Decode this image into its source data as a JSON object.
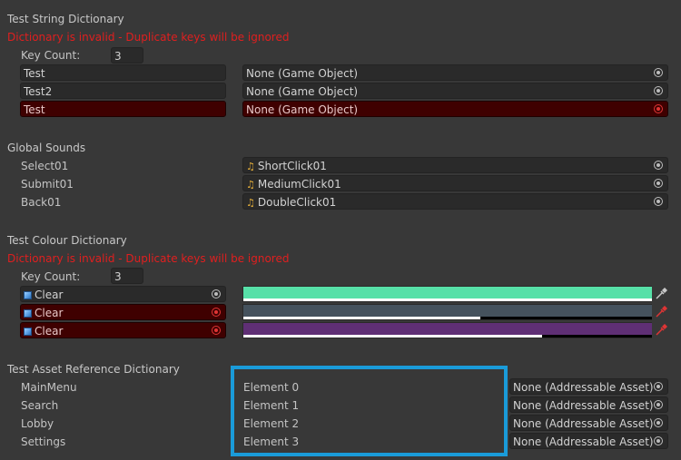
{
  "string_dict": {
    "title": "Test String Dictionary",
    "error": "Dictionary is invalid - Duplicate keys will be ignored",
    "key_count_label": "Key Count:",
    "key_count": "3",
    "entries": [
      {
        "key": "Test",
        "value": "None (Game Object)",
        "duplicate": false
      },
      {
        "key": "Test2",
        "value": "None (Game Object)",
        "duplicate": false
      },
      {
        "key": "Test",
        "value": "None (Game Object)",
        "duplicate": true
      }
    ]
  },
  "global_sounds": {
    "title": "Global Sounds",
    "entries": [
      {
        "key": "Select01",
        "value": "ShortClick01"
      },
      {
        "key": "Submit01",
        "value": "MediumClick01"
      },
      {
        "key": "Back01",
        "value": "DoubleClick01"
      }
    ]
  },
  "colour_dict": {
    "title": "Test Colour Dictionary",
    "error": "Dictionary is invalid - Duplicate keys will be ignored",
    "key_count_label": "Key Count:",
    "key_count": "3",
    "entries": [
      {
        "key": "Clear",
        "color": "#57e0a8",
        "alpha": 1.0,
        "duplicate": false
      },
      {
        "key": "Clear",
        "color": "#45525d",
        "alpha": 0.58,
        "duplicate": true
      },
      {
        "key": "Clear",
        "color": "#5f2f75",
        "alpha": 0.73,
        "duplicate": true
      }
    ]
  },
  "asset_dict": {
    "title": "Test Asset Reference Dictionary",
    "entries": [
      {
        "key": "MainMenu",
        "element": "Element 0",
        "value": "None (Addressable Asset)"
      },
      {
        "key": "Search",
        "element": "Element 1",
        "value": "None (Addressable Asset)"
      },
      {
        "key": "Lobby",
        "element": "Element 2",
        "value": "None (Addressable Asset)"
      },
      {
        "key": "Settings",
        "element": "Element 3",
        "value": "None (Addressable Asset)"
      }
    ],
    "highlight_color": "#1a9bd9"
  },
  "icons": {
    "object_picker": "object-picker-icon",
    "audio_clip": "audio-clip-icon",
    "cube": "prefab-cube-icon",
    "eyedropper": "eyedropper-icon"
  }
}
